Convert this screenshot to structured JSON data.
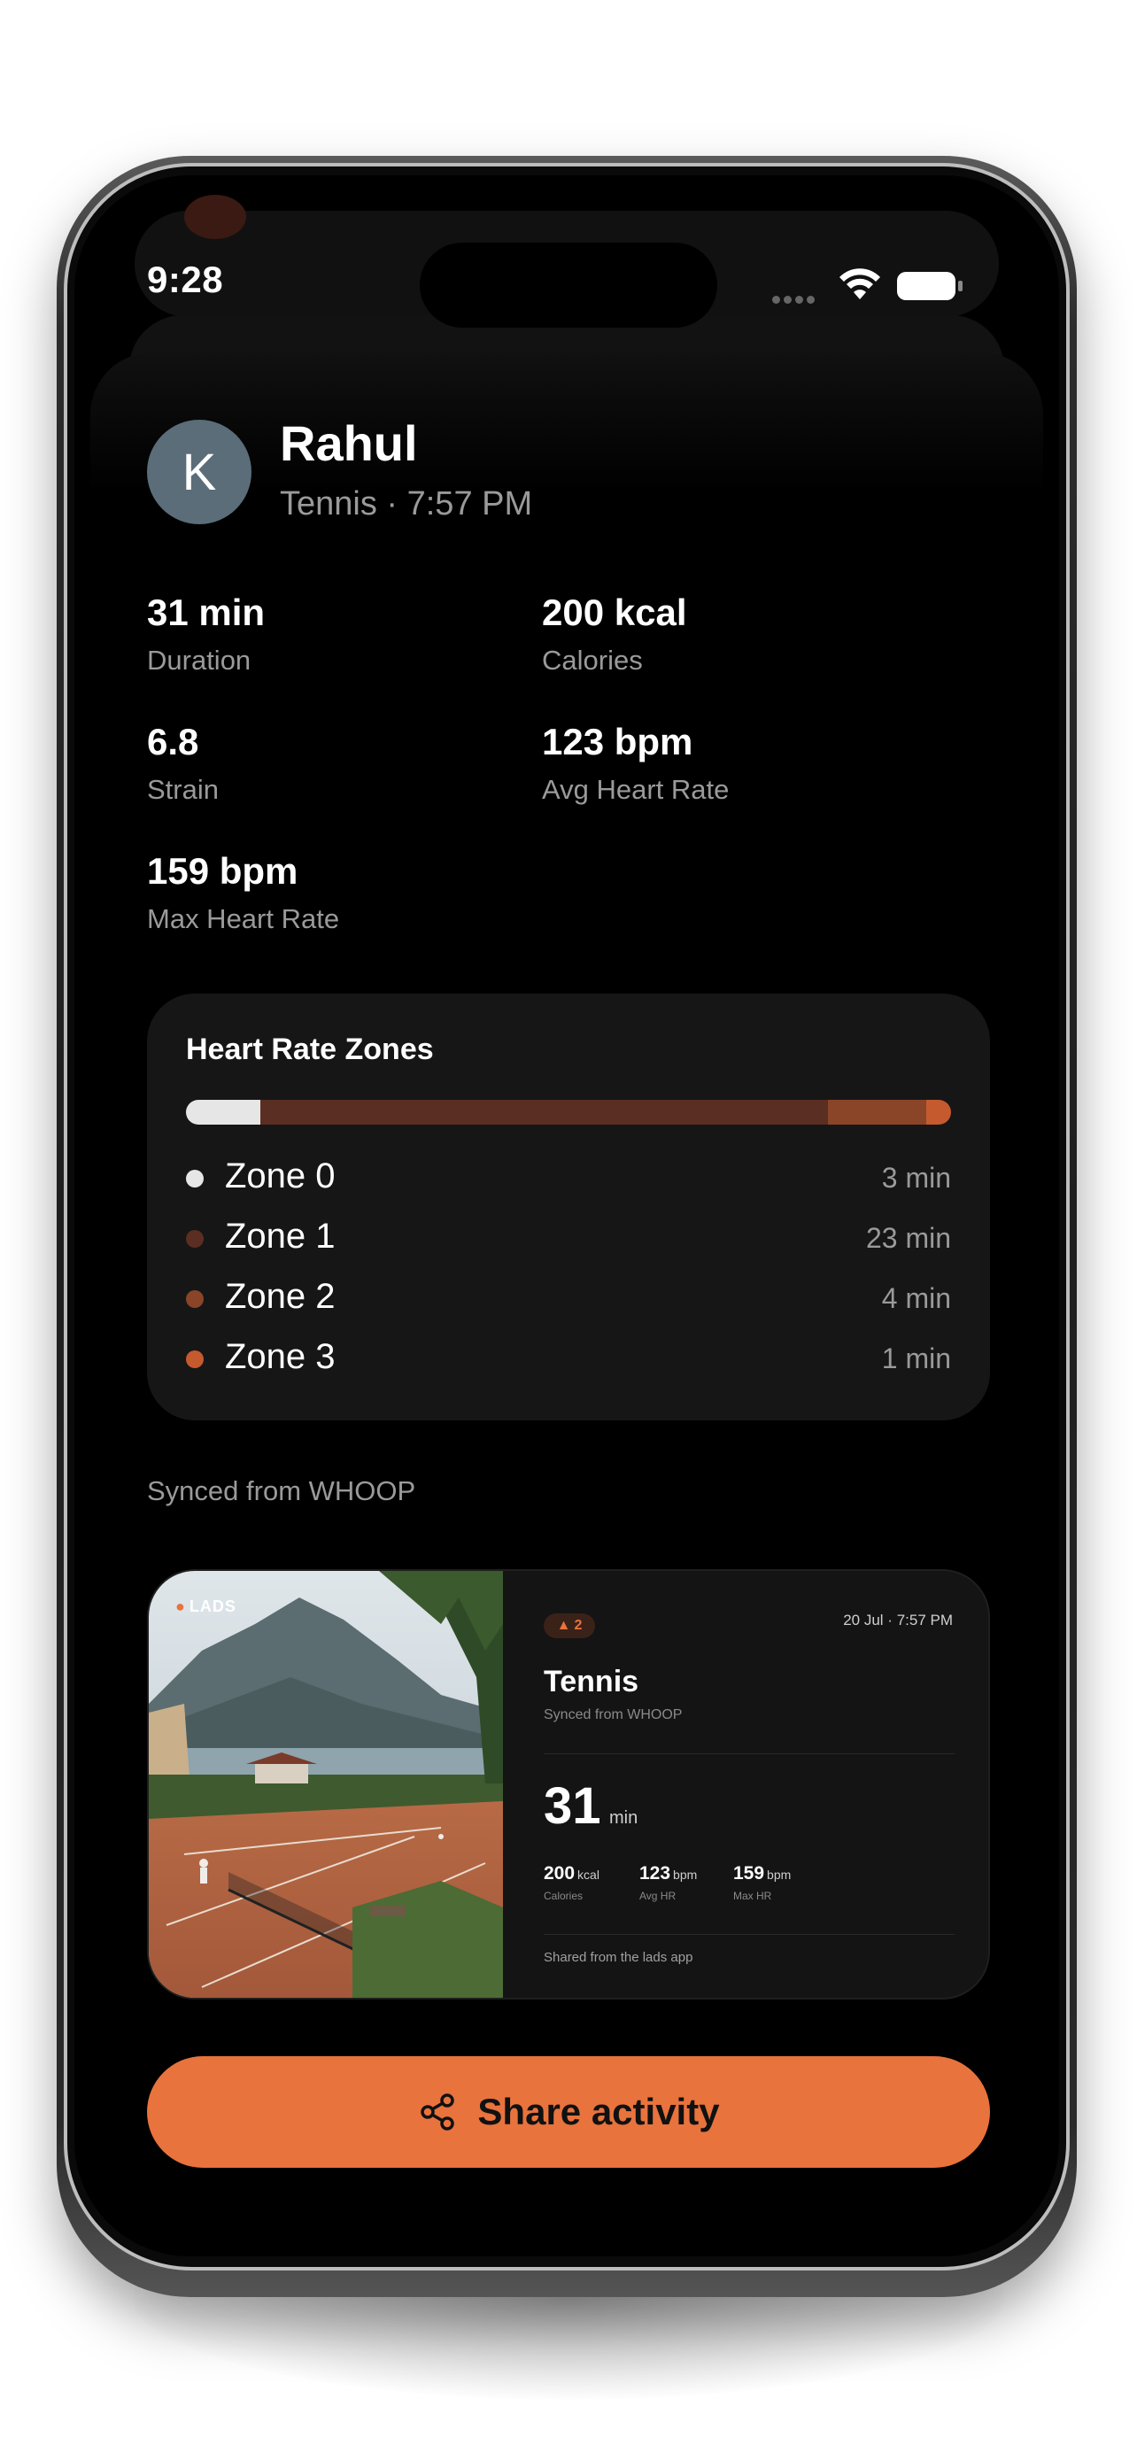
{
  "status_bar": {
    "time": "9:28"
  },
  "user": {
    "initial": "K",
    "name": "Rahul",
    "activity": "Tennis · 7:57 PM"
  },
  "stats": [
    {
      "value": "31 min",
      "label": "Duration"
    },
    {
      "value": "200 kcal",
      "label": "Calories"
    },
    {
      "value": "6.8",
      "label": "Strain"
    },
    {
      "value": "123 bpm",
      "label": "Avg Heart Rate"
    },
    {
      "value": "159 bpm",
      "label": "Max Heart Rate"
    }
  ],
  "heart_rate_zones": {
    "title": "Heart Rate Zones",
    "zones": [
      {
        "name": "Zone 0",
        "time": "3 min",
        "minutes": 3,
        "color": "#e6e6e6"
      },
      {
        "name": "Zone 1",
        "time": "23 min",
        "minutes": 23,
        "color": "#5a2e22"
      },
      {
        "name": "Zone 2",
        "time": "4 min",
        "minutes": 4,
        "color": "#8a4428"
      },
      {
        "name": "Zone 3",
        "time": "1 min",
        "minutes": 1,
        "color": "#c45a2e"
      }
    ]
  },
  "synced_text": "Synced from WHOOP",
  "share_preview": {
    "brand": "LADS",
    "pill": "2",
    "date": "20 Jul · 7:57 PM",
    "title": "Tennis",
    "subtitle": "Synced from WHOOP",
    "big_value": "31",
    "big_unit": "min",
    "metrics": [
      {
        "value": "200",
        "unit": "kcal",
        "label": "Calories"
      },
      {
        "value": "123",
        "unit": "bpm",
        "label": "Avg HR"
      },
      {
        "value": "159",
        "unit": "bpm",
        "label": "Max HR"
      }
    ],
    "footer": "Shared from the lads app"
  },
  "share_button": {
    "label": "Share activity"
  },
  "colors": {
    "accent": "#e8733d",
    "background": "#000000",
    "card": "#161616"
  }
}
